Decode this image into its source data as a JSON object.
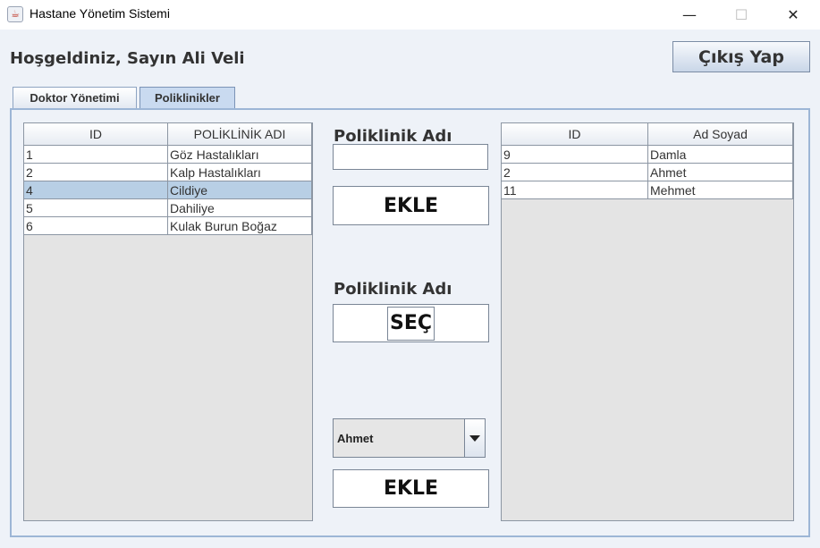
{
  "window": {
    "title": "Hastane Yönetim Sistemi",
    "minimize_glyph": "—",
    "maximize_glyph": "☐",
    "close_glyph": "✕"
  },
  "header": {
    "welcome": "Hoşgeldiniz, Sayın Ali Veli",
    "logout_label": "Çıkış Yap"
  },
  "tabs": [
    {
      "label": "Doktor Yönetimi",
      "active": false
    },
    {
      "label": "Poliklinikler",
      "active": true
    }
  ],
  "clinic_table": {
    "headers": [
      "ID",
      "POLİKLİNİK ADI"
    ],
    "rows": [
      {
        "id": "1",
        "name": "Göz Hastalıkları",
        "selected": false
      },
      {
        "id": "2",
        "name": "Kalp Hastalıkları",
        "selected": false
      },
      {
        "id": "4",
        "name": "Cildiye",
        "selected": true
      },
      {
        "id": "5",
        "name": "Dahiliye",
        "selected": false
      },
      {
        "id": "6",
        "name": "Kulak Burun Boğaz",
        "selected": false
      }
    ]
  },
  "add_clinic": {
    "label": "Poliklinik Adı",
    "input_value": "",
    "button_label": "EKLE"
  },
  "select_clinic": {
    "label": "Poliklinik Adı",
    "button_label": "SEÇ"
  },
  "doctor_assign": {
    "selected_doctor": "Ahmet",
    "button_label": "EKLE"
  },
  "doctor_table": {
    "headers": [
      "ID",
      "Ad Soyad"
    ],
    "rows": [
      {
        "id": "9",
        "name": "Damla"
      },
      {
        "id": "2",
        "name": "Ahmet"
      },
      {
        "id": "11",
        "name": "Mehmet"
      }
    ]
  },
  "colors": {
    "selection": "#b8cfe5",
    "panel_border": "#9db6d6",
    "active_tab": "#c9daf0"
  }
}
